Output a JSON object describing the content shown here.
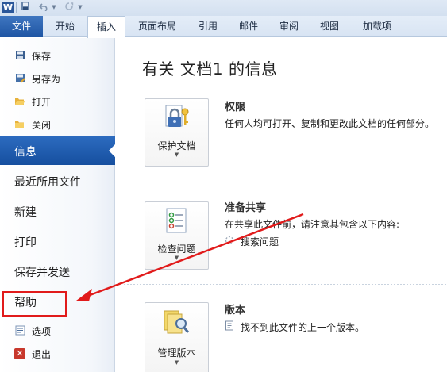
{
  "quick_access": {
    "app_icon": "word-icon",
    "app_letter": "W",
    "save_icon": "save-icon",
    "undo_icon": "undo-icon",
    "redo_icon": "redo-icon"
  },
  "tabs": [
    {
      "label": "文件"
    },
    {
      "label": "开始"
    },
    {
      "label": "插入"
    },
    {
      "label": "页面布局"
    },
    {
      "label": "引用"
    },
    {
      "label": "邮件"
    },
    {
      "label": "审阅"
    },
    {
      "label": "视图"
    },
    {
      "label": "加载项"
    }
  ],
  "active_tab_index": 2,
  "nav": {
    "save": {
      "label": "保存",
      "icon": "save-icon"
    },
    "save_as": {
      "label": "另存为",
      "icon": "save-as-icon"
    },
    "open": {
      "label": "打开",
      "icon": "open-folder-icon"
    },
    "close": {
      "label": "关闭",
      "icon": "close-folder-icon"
    },
    "info": {
      "label": "信息"
    },
    "recent": {
      "label": "最近所用文件"
    },
    "new": {
      "label": "新建"
    },
    "print": {
      "label": "打印"
    },
    "save_send": {
      "label": "保存并发送"
    },
    "help": {
      "label": "帮助"
    },
    "options": {
      "label": "选项",
      "icon": "options-icon"
    },
    "exit": {
      "label": "退出",
      "icon": "exit-icon"
    }
  },
  "main": {
    "title": "有关 文档1 的信息",
    "sections": [
      {
        "button_label": "保护文档",
        "button_icon": "lock-key-icon",
        "heading": "权限",
        "description": "任何人均可打开、复制和更改此文档的任何部分。"
      },
      {
        "button_label": "检查问题",
        "button_icon": "checklist-icon",
        "heading": "准备共享",
        "description": "在共享此文件前，请注意其包含以下内容:",
        "sub_items": [
          {
            "label": "搜索问题",
            "icon": "loading-icon"
          }
        ]
      },
      {
        "button_label": "管理版本",
        "button_icon": "versions-search-icon",
        "heading": "版本",
        "sub_items": [
          {
            "label": "找不到此文件的上一个版本。",
            "icon": "document-icon"
          }
        ]
      }
    ]
  },
  "annotation": {
    "color": "#e11b1b"
  },
  "colors": {
    "accent": "#1e55a3",
    "highlight": "#e11b1b"
  }
}
